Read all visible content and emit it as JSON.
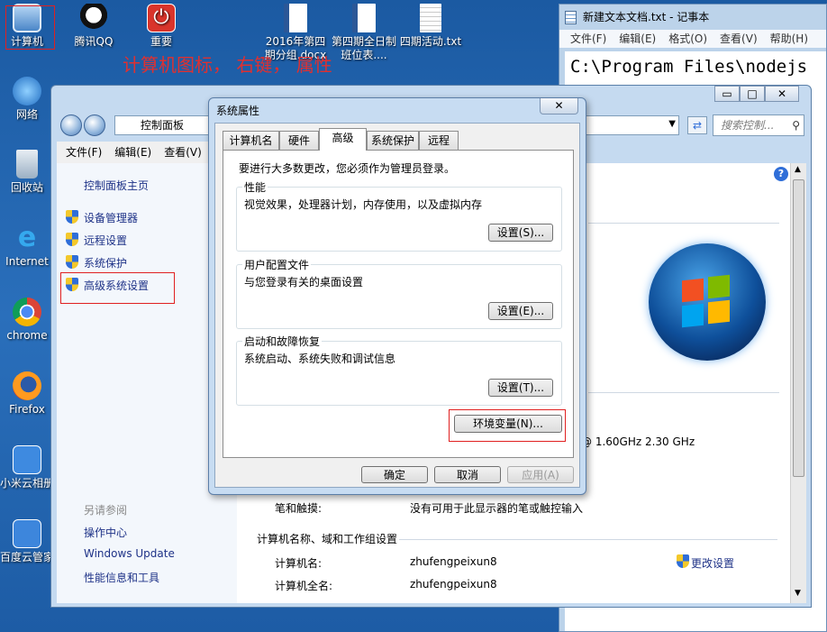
{
  "desktop": {
    "icons": [
      {
        "label": "计算机",
        "icon": "computer-icon"
      },
      {
        "label": "腾讯QQ",
        "icon": "qq-icon"
      },
      {
        "label": "重要",
        "icon": "power-icon"
      },
      {
        "label": "2016年第四期分组.docx",
        "icon": "word-doc-icon"
      },
      {
        "label": "第四期全日制班位表....",
        "icon": "word-doc-icon"
      },
      {
        "label": "四期活动.txt",
        "icon": "text-file-icon"
      },
      {
        "label": "网络",
        "icon": "network-icon"
      },
      {
        "label": "回收站",
        "icon": "recycle-bin-icon"
      },
      {
        "label": "Internet",
        "icon": "internet-explorer-icon"
      },
      {
        "label": "chrome",
        "icon": "chrome-icon"
      },
      {
        "label": "Firefox",
        "icon": "firefox-icon"
      },
      {
        "label": "小米云相册",
        "icon": "xiaomi-cloud-icon"
      },
      {
        "label": "百度云管家",
        "icon": "baidu-cloud-icon"
      }
    ],
    "annotation": "计算机图标，  右键，  属性"
  },
  "notepad": {
    "title": "新建文本文档.txt - 记事本",
    "menu": [
      "文件(F)",
      "编辑(E)",
      "格式(O)",
      "查看(V)",
      "帮助(H)"
    ],
    "content": "C:\\Program Files\\nodejs"
  },
  "control_panel": {
    "address": "控制面板",
    "search_placeholder": "搜索控制...",
    "menu": [
      "文件(F)",
      "编辑(E)",
      "查看(V)"
    ],
    "side_home": "控制面板主页",
    "side_links": [
      "设备管理器",
      "远程设置",
      "系统保护",
      "高级系统设置"
    ],
    "see_also_title": "另请参阅",
    "see_also": [
      "操作中心",
      "Windows Update",
      "性能信息和工具"
    ],
    "cpu": "@ 1.60GHz   2.30 GHz",
    "pen_label": "笔和触摸:",
    "pen_value": "没有可用于此显示器的笔或触控输入",
    "section_title": "计算机名称、域和工作组设置",
    "computer_name_label": "计算机名:",
    "computer_name_value": "zhufengpeixun8",
    "full_name_label": "计算机全名:",
    "full_name_value": "zhufengpeixun8",
    "change_settings": "更改设置"
  },
  "dialog": {
    "title": "系统属性",
    "close": "✕",
    "tabs": [
      "计算机名",
      "硬件",
      "高级",
      "系统保护",
      "远程"
    ],
    "active_tab": "高级",
    "admin_note": "要进行大多数更改，您必须作为管理员登录。",
    "groups": [
      {
        "title": "性能",
        "desc": "视觉效果，处理器计划，内存使用，以及虚拟内存",
        "button": "设置(S)..."
      },
      {
        "title": "用户配置文件",
        "desc": "与您登录有关的桌面设置",
        "button": "设置(E)..."
      },
      {
        "title": "启动和故障恢复",
        "desc": "系统启动、系统失败和调试信息",
        "button": "设置(T)..."
      }
    ],
    "env_button": "环境变量(N)...",
    "ok": "确定",
    "cancel": "取消",
    "apply": "应用(A)"
  },
  "colors": {
    "annotation_red": "#e02020",
    "link_blue": "#1e3287",
    "desktop": "#1e5fa8"
  }
}
